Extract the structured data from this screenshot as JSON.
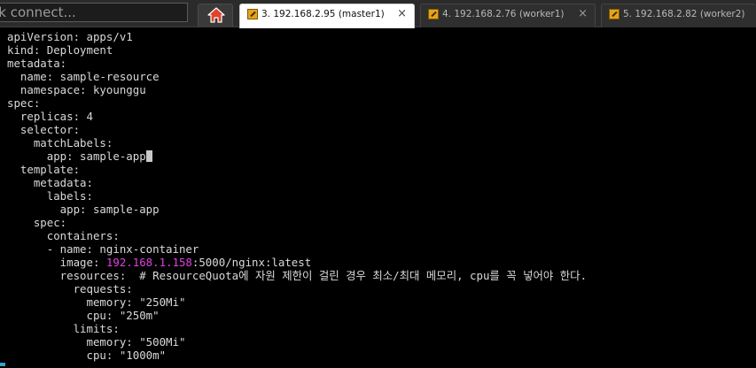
{
  "toolbar": {
    "quick_connect_text": "ck connect..."
  },
  "tabs": [
    {
      "label": "3. 192.168.2.95 (master1)",
      "close": "×",
      "active": true
    },
    {
      "label": "4. 192.168.2.76 (worker1)",
      "close": "×",
      "active": false
    },
    {
      "label": "5. 192.168.2.82 (worker2)",
      "close": "×",
      "active": false
    }
  ],
  "terminal": {
    "cursor_line": 9,
    "lines": [
      {
        "pre": "apiVersion: apps/v1"
      },
      {
        "pre": "kind: Deployment"
      },
      {
        "pre": "metadata:"
      },
      {
        "pre": "  name: sample-resource"
      },
      {
        "pre": "  namespace: kyounggu"
      },
      {
        "pre": "spec:"
      },
      {
        "pre": "  replicas: 4"
      },
      {
        "pre": "  selector:"
      },
      {
        "pre": "    matchLabels:"
      },
      {
        "pre": "      app: sample-app"
      },
      {
        "pre": "  template:"
      },
      {
        "pre": "    metadata:"
      },
      {
        "pre": "      labels:"
      },
      {
        "pre": "        app: sample-app"
      },
      {
        "pre": "    spec:"
      },
      {
        "pre": "      containers:"
      },
      {
        "pre": "      - name: nginx-container"
      },
      {
        "pre": "        image: ",
        "ip": "192.168.1.158",
        "post": ":5000/nginx:latest"
      },
      {
        "pre": "        resources:  # ResourceQuota에 자원 제한이 걸린 경우 최소/최대 메모리, cpu를 꼭 넣어야 한다."
      },
      {
        "pre": "          requests:"
      },
      {
        "pre": "            memory: \"250Mi\""
      },
      {
        "pre": "            cpu: \"250m\""
      },
      {
        "pre": "          limits:"
      },
      {
        "pre": "            memory: \"500Mi\""
      },
      {
        "pre": "            cpu: \"1000m\""
      }
    ]
  },
  "colors": {
    "terminal_bg": "#000000",
    "text": "#d9d9d9",
    "ip_highlight": "#e040e0",
    "tab_icon": "#e8a21a",
    "home_icon": "#e0442a"
  }
}
